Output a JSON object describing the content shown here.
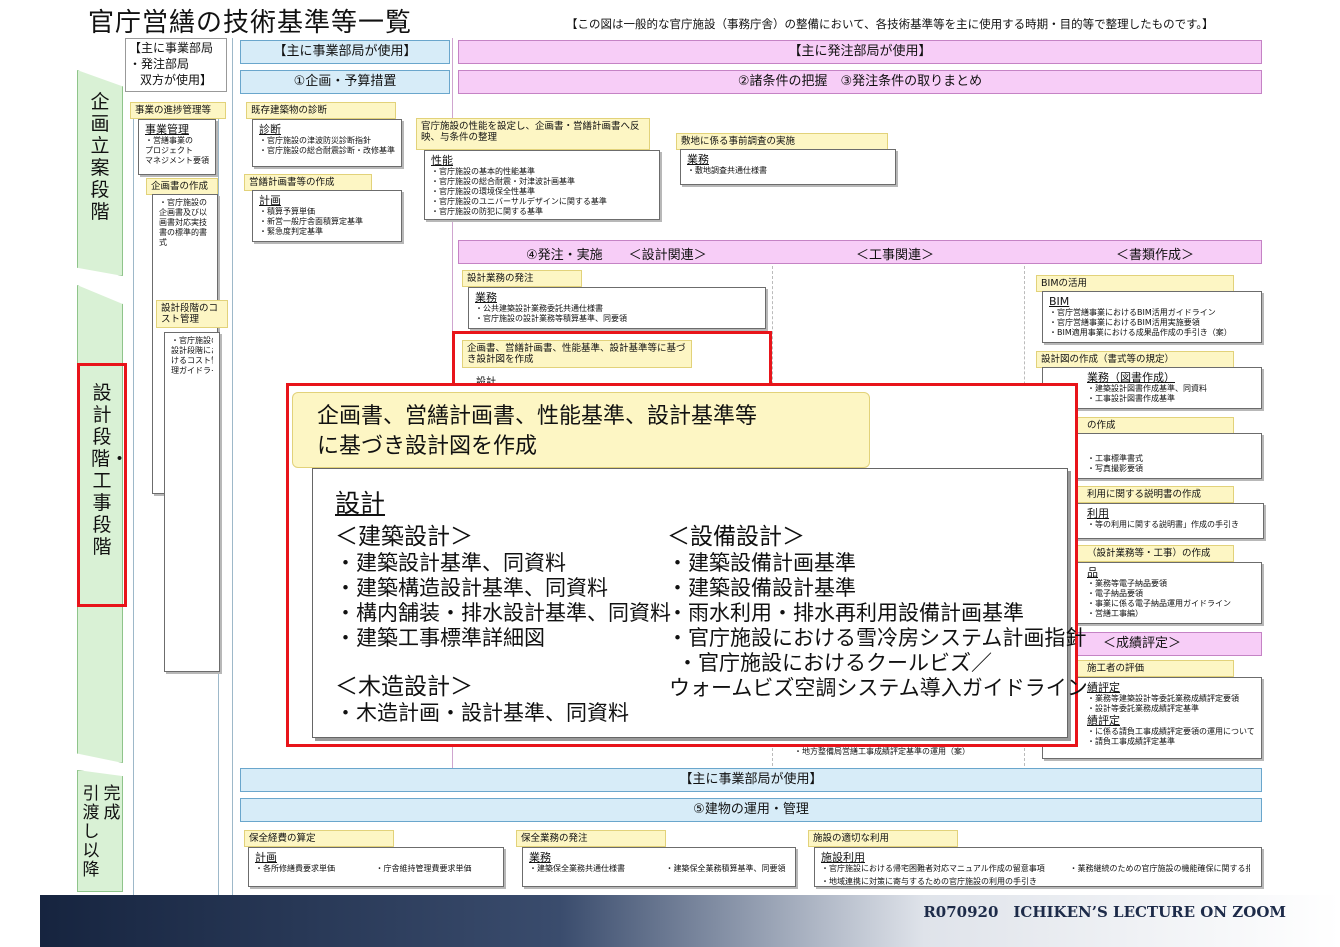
{
  "title": "官庁営繕の技術基準等一覧",
  "note": "【この図は一般的な官庁施設（事務庁舎）の整備において、各技術基準等を主に使用する時期・目的等で整理したものです。】",
  "headers": {
    "both": [
      "【主に事業部局",
      "・発注部局",
      "双方が使用】"
    ],
    "business": "【主に事業部局が使用】",
    "ordering": "【主に発注部局が使用】",
    "step1": "①企画・予算措置",
    "step23": "②諸条件の把握　③発注条件の取りまとめ",
    "step4": "④発注・実施　　＜設計関連＞",
    "step4_construct": "＜工事関連＞",
    "step4_docs": "＜書類作成＞",
    "business_bottom": "【主に事業部局が使用】",
    "step5": "⑤建物の運用・管理"
  },
  "stages": {
    "planning": "企画立案段階",
    "design": "設計段階・工事段階",
    "handover_a": "完成",
    "handover_b": "引渡し以降"
  },
  "labels": {
    "progress": "事業の進捗管理等",
    "existing": "既存建築物の診断",
    "performance": "官庁施設の性能を設定し、企画書・営繕計画書へ反映、与条件の整理",
    "site": "敷地に係る事前調査の実施",
    "plan_doc": "企画書の作成",
    "eizen_plan": "営繕計画書等の作成",
    "cost": "設計段階のコスト管理",
    "design_order": "設計業務の発注",
    "design_make": "企画書、営繕計画書、性能基準、設計基準等に基づき設計図を作成",
    "bim": "BIMの活用",
    "drawing_fmt": "設計図の作成（書式等の規定）",
    "doc_make": "の作成",
    "explain": "利用に関する説明書の作成",
    "deliver": "（設計業務等・工事）の作成",
    "eval_head": "＜成績評定＞",
    "eval": "施工者の評価",
    "maint_cost": "保全経費の算定",
    "maint_order": "保全業務の発注",
    "facility_use": "施設の適切な利用"
  },
  "boxes": {
    "jigyo": {
      "head": "事業管理",
      "items": [
        "・営繕事業の",
        "プロジェクト",
        "マネジメント要領"
      ]
    },
    "shindan": {
      "head": "診断",
      "items": [
        "・官庁施設の津波防災診断指針",
        "・官庁施設の総合耐震診断・改修基準"
      ]
    },
    "seino": {
      "head": "性能",
      "items": [
        "・官庁施設の基本的性能基準",
        "・官庁施設の総合耐震・対津波計画基準",
        "・官庁施設の環境保全性基準",
        "・官庁施設のユニバーサルデザインに関する基準",
        "・官庁施設の防犯に関する基準"
      ]
    },
    "gyomu_site": {
      "head": "業務",
      "items": [
        "・敷地調査共通仕様書"
      ]
    },
    "kikaku": {
      "items": [
        "・官庁施設の",
        "企画書及び以",
        "画書対応実技",
        "書の標準的書",
        "式"
      ]
    },
    "keikaku": {
      "head": "計画",
      "items": [
        "・積算予算単価",
        "・新営一般庁舎面積算定基準",
        "・緊急度判定基準"
      ]
    },
    "cost": {
      "items": [
        "・官庁施設の",
        "設計段階にお",
        "けるコスト管",
        "理ガイドライン"
      ]
    },
    "design_gyomu": {
      "head": "業務",
      "items": [
        "・公共建築設計業務委託共通仕様書",
        "・官庁施設の設計業務等積算基準、同要領"
      ]
    },
    "design_small": {
      "head": "設計"
    },
    "bim_box": {
      "head": "BIM",
      "items": [
        "・官庁営繕事業におけるBIM活用ガイドライン",
        "・官庁営繕事業におけるBIM活用実施要領",
        "・BIM適用事業における成果品作成の手引き（案）"
      ]
    },
    "zumen": {
      "head": "業務（図書作成）",
      "items": [
        "・建築設計図書作成基準、同資料",
        "・工事設計図書作成基準"
      ]
    },
    "kouji_doc": {
      "items": [
        "・工事標準書式",
        "・写真撮影要領"
      ]
    },
    "riyo": {
      "head": "利用",
      "items": [
        "・等の利用に関する説明書」作成の手引き"
      ]
    },
    "seika": {
      "head": "品",
      "items": [
        "・業務等電子納品要領",
        "・電子納品要領",
        "・事業に係る電子納品運用ガイドライン",
        "・営繕工事編）"
      ]
    },
    "hyotei": {
      "head": "績評定",
      "items": [
        "・業務等建築設計等委託業務成績評定要領",
        "・設計等委託業務成績評定基準"
      ]
    },
    "hyotei2": {
      "head": "績評定",
      "items": [
        "・に係る請負工事成績評定要領の運用について",
        "・請負工事成績評定基準"
      ]
    },
    "area": {
      "items": [
        "・地方整備局営繕工事成績評定基準の運用（案）"
      ]
    },
    "hozen_keikaku": {
      "head": "計画",
      "items": [
        "・各所修繕費要求単価",
        "・庁舎維持管理費要求単価"
      ]
    },
    "hozen_gyomu": {
      "head": "業務",
      "items": [
        "・建築保全業務共通仕様書",
        "・建築保全業務積算基準、同要領"
      ]
    },
    "shisetsu": {
      "head": "施設利用",
      "items": [
        "・官庁施設における帰宅困難者対応マニュアル作成の留意事項",
        "・業務継続のための官庁施設の機能確保に関する指針",
        "・地域連携に対策に寄与するための官庁施設の利用の手引き"
      ]
    }
  },
  "zoom": {
    "label_line1": "企画書、営繕計画書、性能基準、設計基準等",
    "label_line2": "に基づき設計図を作成",
    "head": "設計",
    "arch_head": "＜建築設計＞",
    "arch_items": [
      "・建築設計基準、同資料",
      "・建築構造設計基準、同資料",
      "・構内舗装・排水設計基準、同資料",
      "・建築工事標準詳細図"
    ],
    "wood_head": "＜木造設計＞",
    "wood_items": [
      "・木造計画・設計基準、同資料"
    ],
    "equip_head": "＜設備設計＞",
    "equip_items": [
      "・建築設備計画基準",
      "・建築設備設計基準",
      "・雨水利用・排水再利用設備計画基準",
      "・官庁施設における雪冷房システム計画指針",
      "・官庁施設におけるクールビズ／",
      "ウォームビズ空調システム導入ガイドライン"
    ]
  },
  "footer": "R070920　ICHIKEN’S LECTURE ON ZOOM",
  "colors": {
    "accent_red": "#e8141a",
    "blue": "#d7ecf8",
    "pink": "#f7cdf7",
    "yellow": "#fdf6c4",
    "green": "#d9f1d5"
  }
}
